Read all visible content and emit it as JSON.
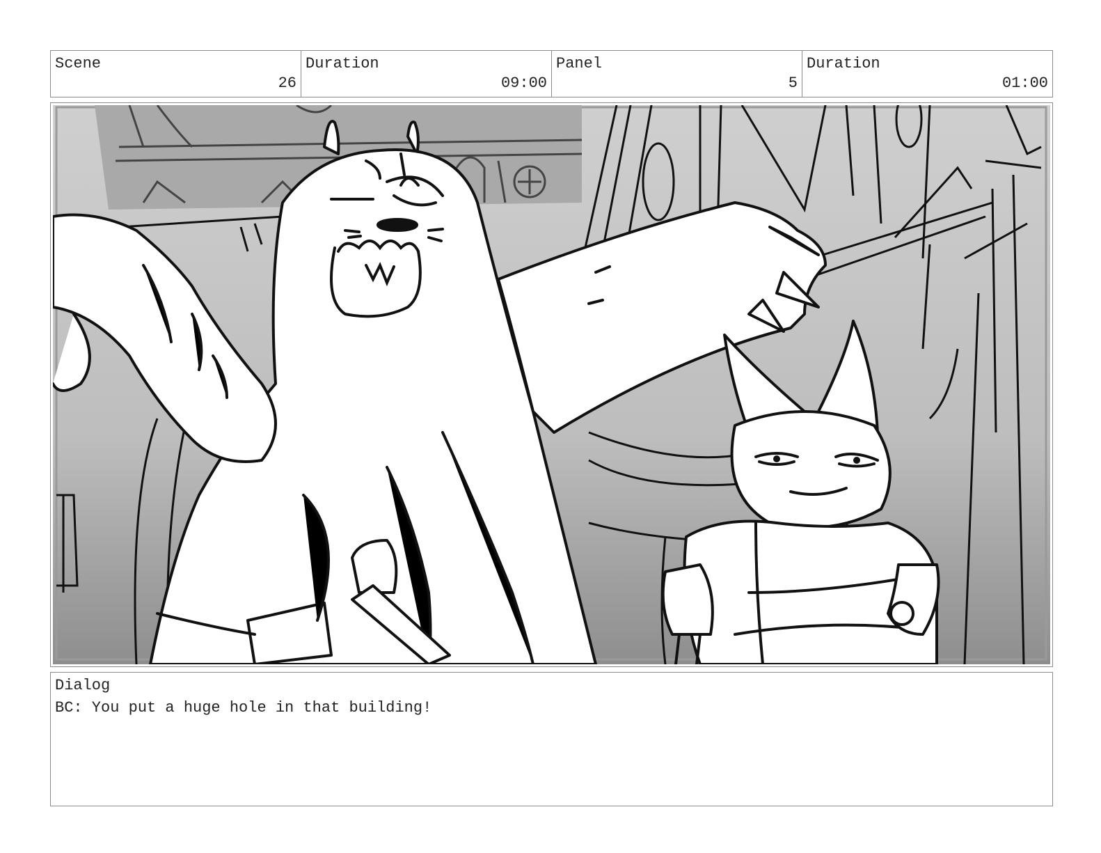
{
  "header": {
    "scene": {
      "label": "Scene",
      "value": "26"
    },
    "scene_duration": {
      "label": "Duration",
      "value": "09:00"
    },
    "panel": {
      "label": "Panel",
      "value": "5"
    },
    "panel_duration": {
      "label": "Duration",
      "value": "01:00"
    }
  },
  "dialog": {
    "label": "Dialog",
    "text": "BC: You put a huge hole in that building!"
  },
  "colors": {
    "border": "#8a8a8a",
    "ink": "#111111",
    "sky_light": "#d8d8d8",
    "sky_dark": "#8e8e8e",
    "paper": "#ffffff"
  }
}
